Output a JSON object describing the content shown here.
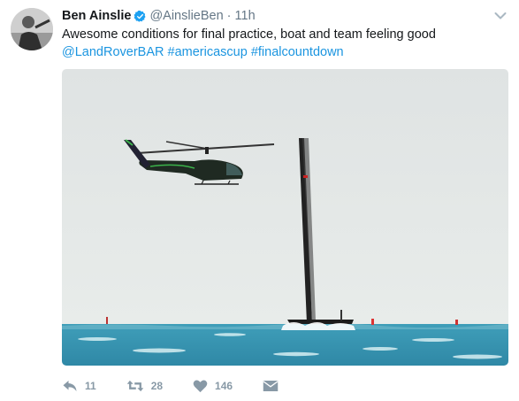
{
  "tweet": {
    "author_name": "Ben Ainslie",
    "handle": "@AinslieBen",
    "separator": "·",
    "time": "11h",
    "text": "Awesome conditions for final practice, boat and team feeling good",
    "tags": [
      "@LandRoverBAR",
      "#americascup",
      "#finalcountdown"
    ]
  },
  "actions": {
    "reply_count": "11",
    "retweet_count": "28",
    "like_count": "146"
  },
  "colors": {
    "link": "#1b95e0",
    "verified": "#1da1f2",
    "icon_gray": "#8899a6"
  },
  "icons": [
    "verified-badge-icon",
    "chevron-down-icon",
    "reply-icon",
    "retweet-icon",
    "heart-icon",
    "direct-message-icon"
  ]
}
